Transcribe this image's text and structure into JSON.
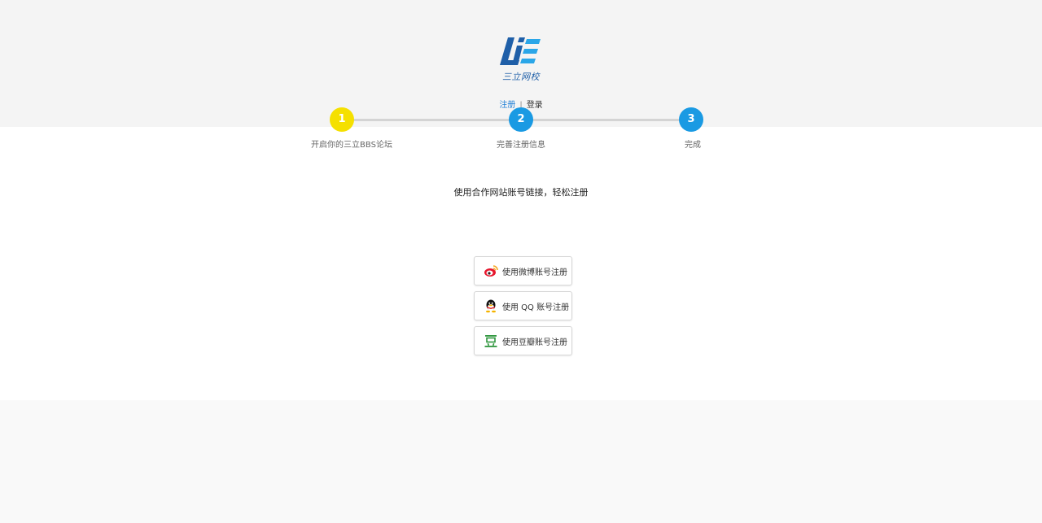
{
  "logo": {
    "text": "三立网校",
    "icon": "lie-logo-icon",
    "colors": {
      "dark": "#1f5fa8",
      "light": "#2aa6e8"
    }
  },
  "auth_nav": {
    "register_label": "注册",
    "separator": "|",
    "login_label": "登录"
  },
  "steps": [
    {
      "number": "1",
      "label": "开启你的三立BBS论坛",
      "color": "#f5e000"
    },
    {
      "number": "2",
      "label": "完善注册信息",
      "color": "#1a9ae3"
    },
    {
      "number": "3",
      "label": "完成",
      "color": "#1a9ae3"
    }
  ],
  "main": {
    "heading": "使用合作网站账号链接，轻松注册",
    "buttons": [
      {
        "label": "使用微博账号注册",
        "icon": "weibo-icon"
      },
      {
        "label": "使用 QQ 账号注册",
        "icon": "qq-icon"
      },
      {
        "label": "使用豆瓣账号注册",
        "icon": "douban-icon"
      }
    ]
  }
}
